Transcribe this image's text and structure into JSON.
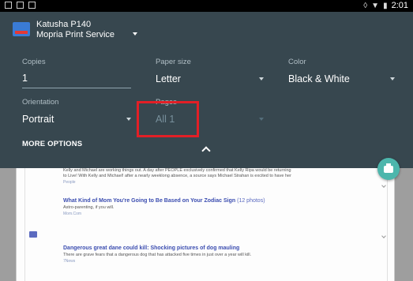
{
  "status_bar": {
    "time": "2:01",
    "icons": [
      "notification-icon",
      "screenshot-icon",
      "sim-icon",
      "vibrate-icon",
      "wifi-icon",
      "battery-icon"
    ]
  },
  "printer": {
    "name": "Katusha P140",
    "service": "Mopria Print Service"
  },
  "fields": {
    "copies": {
      "label": "Copies",
      "value": "1"
    },
    "paper_size": {
      "label": "Paper size",
      "value": "Letter"
    },
    "color": {
      "label": "Color",
      "value": "Black & White"
    },
    "orientation": {
      "label": "Orientation",
      "value": "Portrait"
    },
    "pages": {
      "label": "Pages",
      "value": "All 1"
    }
  },
  "more_options": "MORE OPTIONS",
  "colors": {
    "panel": "#37474f",
    "accent": "#4db6ac",
    "highlight": "#e21f26"
  },
  "preview": {
    "items": [
      {
        "body": "Kelly and Michael are working things out. A day after PEOPLE exclusively confirmed that Kelly Ripa would be returning",
        "body2": "to Live! With Kelly and Michael! after a nearly weeklong absence, a source says Michael Strahan is excited to have her",
        "source": "People"
      },
      {
        "title": "What Kind of Mom You're Going to Be Based on Your Zodiac Sign",
        "count": "(12 photos)",
        "body": "Astro-parenting, if you will.",
        "source": "Mom.Com"
      },
      {
        "title": "Dangerous great dane could kill: Shocking pictures of dog mauling",
        "body": "There are grave fears that a dangerous dog that has attacked five times in just over a year will kill.",
        "source": "7News"
      }
    ]
  }
}
